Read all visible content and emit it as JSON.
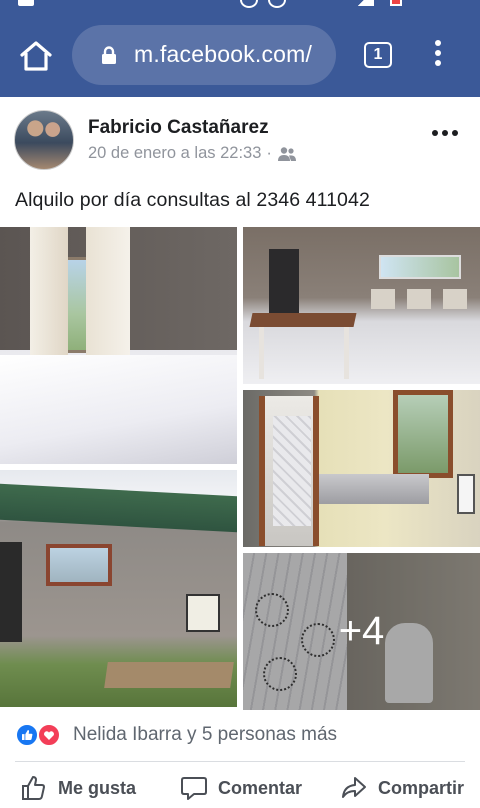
{
  "browser": {
    "url": "m.facebook.com/",
    "tab_count": "1"
  },
  "post": {
    "author": "Fabricio Castañarez",
    "timestamp": "20 de enero a las 22:33",
    "separator": "·",
    "text": "Alquilo por día consultas al 2346 411042",
    "more_photos": "+4"
  },
  "reactions": {
    "summary": "Nelida Ibarra y 5 personas más"
  },
  "actions": {
    "like": "Me gusta",
    "comment": "Comentar",
    "share": "Compartir"
  },
  "colors": {
    "brand": "#3b5998",
    "like": "#1877f2",
    "love": "#f33e58"
  }
}
